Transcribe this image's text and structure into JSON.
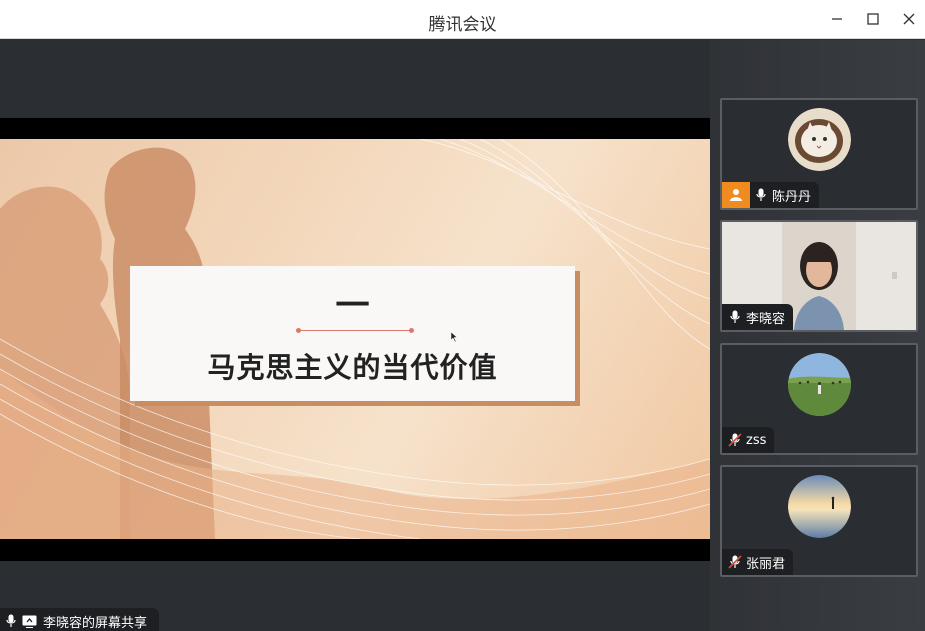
{
  "window": {
    "title": "腾讯会议"
  },
  "slide": {
    "section_number": "一",
    "heading": "马克思主义的当代价值"
  },
  "share_label": {
    "text": "李晓容的屏幕共享"
  },
  "participants": [
    {
      "name": "陈丹丹",
      "mic_muted": false,
      "is_host": true,
      "avatar": "cat-photo"
    },
    {
      "name": "李晓容",
      "mic_muted": false,
      "is_host": false,
      "avatar": "video-feed"
    },
    {
      "name": "zss",
      "mic_muted": true,
      "is_host": false,
      "avatar": "grassland-photo"
    },
    {
      "name": "张丽君",
      "mic_muted": true,
      "is_host": false,
      "avatar": "sunset-beach-photo"
    }
  ],
  "colors": {
    "host_badge": "#f08b1f",
    "muted_mic": "#e04a3b"
  }
}
